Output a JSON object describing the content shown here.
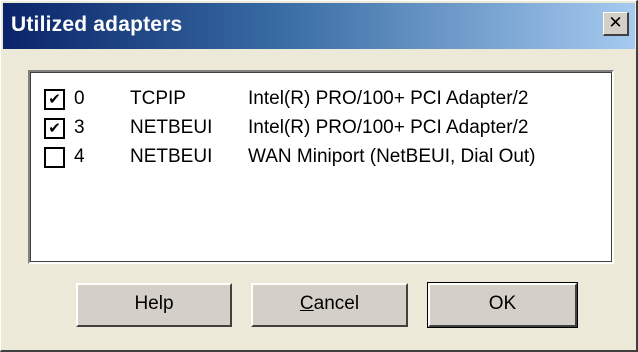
{
  "dialog": {
    "title": "Utilized adapters",
    "close_glyph": "✕"
  },
  "adapters": [
    {
      "checked": true,
      "check_glyph": "✔",
      "number": "0",
      "protocol": "TCPIP",
      "adapter": "Intel(R) PRO/100+ PCI Adapter/2"
    },
    {
      "checked": true,
      "check_glyph": "✔",
      "number": "3",
      "protocol": "NETBEUI",
      "adapter": "Intel(R) PRO/100+ PCI Adapter/2"
    },
    {
      "checked": false,
      "check_glyph": "",
      "number": "4",
      "protocol": "NETBEUI",
      "adapter": "WAN Miniport (NetBEUI, Dial Out)"
    }
  ],
  "buttons": {
    "help": "Help",
    "cancel_accel": "C",
    "cancel_rest": "ancel",
    "ok": "OK"
  }
}
